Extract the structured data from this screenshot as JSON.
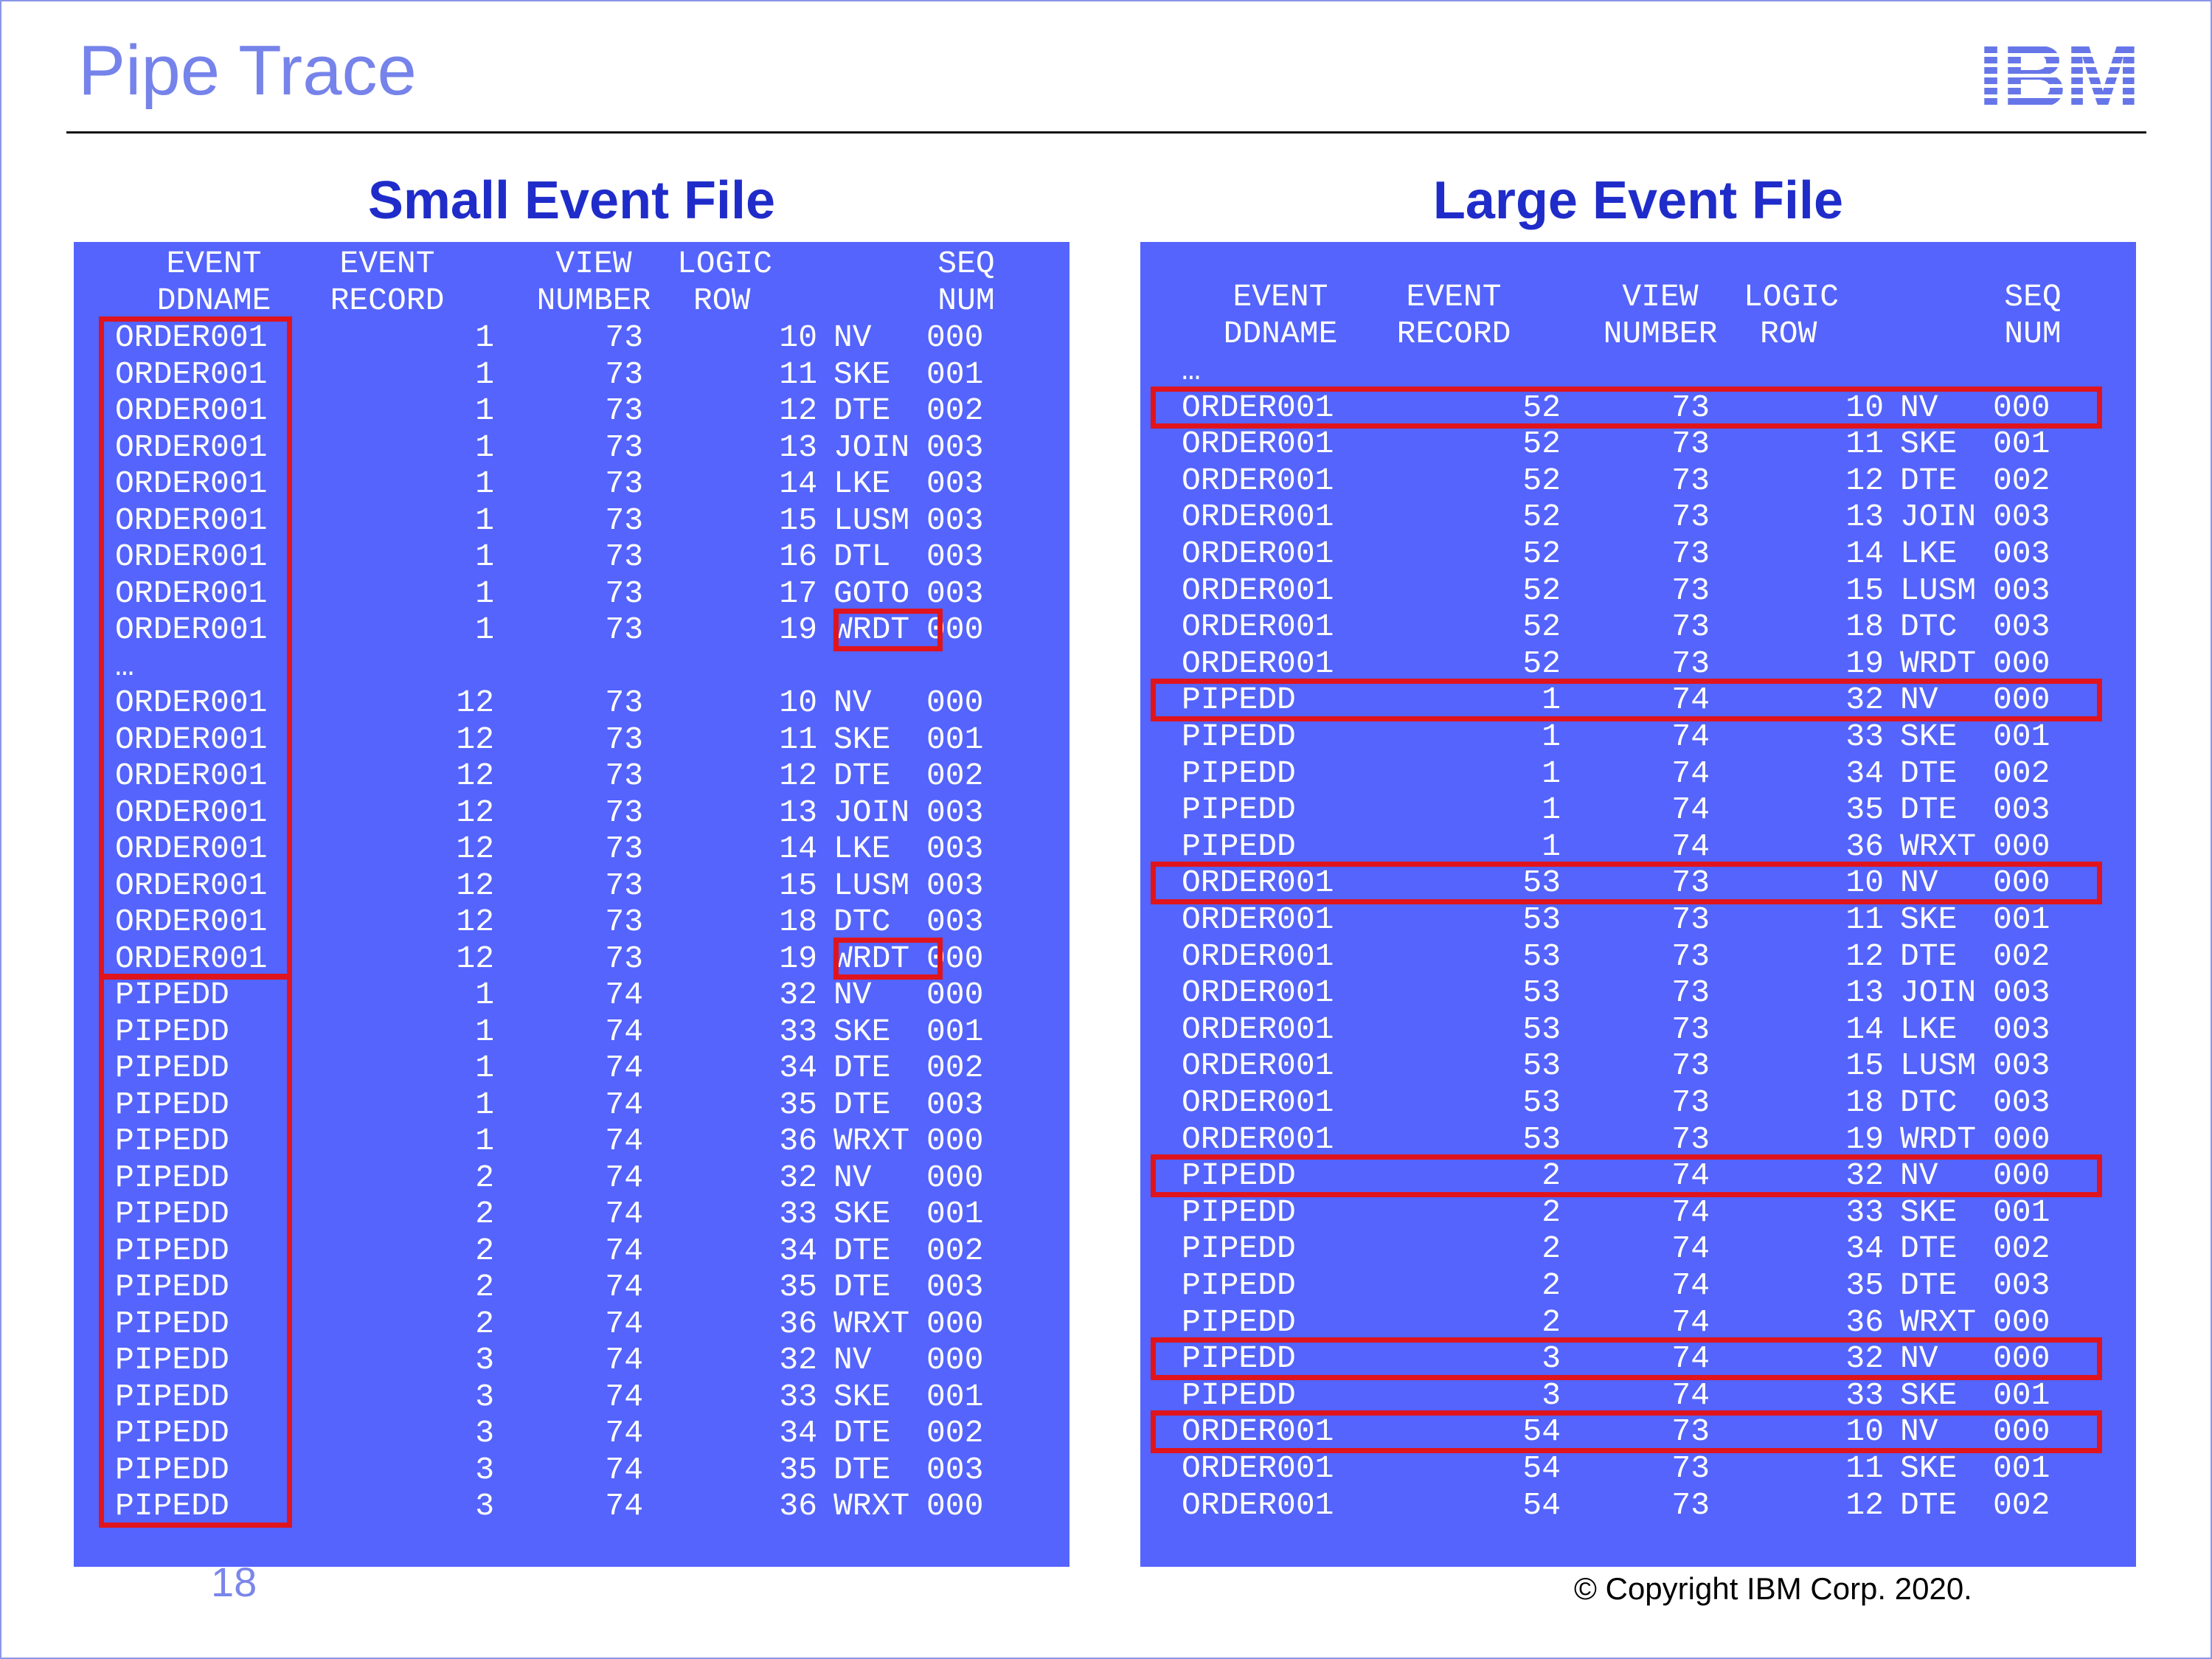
{
  "slide": {
    "title": "Pipe Trace",
    "logo": "IBM",
    "page_number": "18",
    "copyright": "© Copyright IBM Corp. 2020."
  },
  "colors": {
    "title": "#7683ea",
    "panel_background": "#5464fc",
    "panel_heading": "#1f2cc9",
    "highlight_box": "#e0141c"
  },
  "small_file": {
    "heading": "Small Event File",
    "header_row1": [
      "EVENT",
      "EVENT",
      "VIEW",
      "LOGIC",
      "SEQ"
    ],
    "header_row2": [
      "DDNAME",
      "RECORD",
      "NUMBER",
      "ROW",
      "NUM"
    ],
    "rows": [
      [
        "ORDER001",
        "1",
        "73",
        "10",
        "NV",
        "000"
      ],
      [
        "ORDER001",
        "1",
        "73",
        "11",
        "SKE",
        "001"
      ],
      [
        "ORDER001",
        "1",
        "73",
        "12",
        "DTE",
        "002"
      ],
      [
        "ORDER001",
        "1",
        "73",
        "13",
        "JOIN",
        "003"
      ],
      [
        "ORDER001",
        "1",
        "73",
        "14",
        "LKE",
        "003"
      ],
      [
        "ORDER001",
        "1",
        "73",
        "15",
        "LUSM",
        "003"
      ],
      [
        "ORDER001",
        "1",
        "73",
        "16",
        "DTL",
        "003"
      ],
      [
        "ORDER001",
        "1",
        "73",
        "17",
        "GOTO",
        "003"
      ],
      [
        "ORDER001",
        "1",
        "73",
        "19",
        "WRDT",
        "000"
      ],
      [
        "…"
      ],
      [
        "ORDER001",
        "12",
        "73",
        "10",
        "NV",
        "000"
      ],
      [
        "ORDER001",
        "12",
        "73",
        "11",
        "SKE",
        "001"
      ],
      [
        "ORDER001",
        "12",
        "73",
        "12",
        "DTE",
        "002"
      ],
      [
        "ORDER001",
        "12",
        "73",
        "13",
        "JOIN",
        "003"
      ],
      [
        "ORDER001",
        "12",
        "73",
        "14",
        "LKE",
        "003"
      ],
      [
        "ORDER001",
        "12",
        "73",
        "15",
        "LUSM",
        "003"
      ],
      [
        "ORDER001",
        "12",
        "73",
        "18",
        "DTC",
        "003"
      ],
      [
        "ORDER001",
        "12",
        "73",
        "19",
        "WRDT",
        "000"
      ],
      [
        "PIPEDD",
        "1",
        "74",
        "32",
        "NV",
        "000"
      ],
      [
        "PIPEDD",
        "1",
        "74",
        "33",
        "SKE",
        "001"
      ],
      [
        "PIPEDD",
        "1",
        "74",
        "34",
        "DTE",
        "002"
      ],
      [
        "PIPEDD",
        "1",
        "74",
        "35",
        "DTE",
        "003"
      ],
      [
        "PIPEDD",
        "1",
        "74",
        "36",
        "WRXT",
        "000"
      ],
      [
        "PIPEDD",
        "2",
        "74",
        "32",
        "NV",
        "000"
      ],
      [
        "PIPEDD",
        "2",
        "74",
        "33",
        "SKE",
        "001"
      ],
      [
        "PIPEDD",
        "2",
        "74",
        "34",
        "DTE",
        "002"
      ],
      [
        "PIPEDD",
        "2",
        "74",
        "35",
        "DTE",
        "003"
      ],
      [
        "PIPEDD",
        "2",
        "74",
        "36",
        "WRXT",
        "000"
      ],
      [
        "PIPEDD",
        "3",
        "74",
        "32",
        "NV",
        "000"
      ],
      [
        "PIPEDD",
        "3",
        "74",
        "33",
        "SKE",
        "001"
      ],
      [
        "PIPEDD",
        "3",
        "74",
        "34",
        "DTE",
        "002"
      ],
      [
        "PIPEDD",
        "3",
        "74",
        "35",
        "DTE",
        "003"
      ],
      [
        "PIPEDD",
        "3",
        "74",
        "36",
        "WRXT",
        "000"
      ]
    ]
  },
  "large_file": {
    "heading": "Large Event File",
    "header_row1": [
      "EVENT",
      "EVENT",
      "VIEW",
      "LOGIC",
      "SEQ"
    ],
    "header_row2": [
      "DDNAME",
      "RECORD",
      "NUMBER",
      "ROW",
      "NUM"
    ],
    "rows": [
      [
        "…"
      ],
      [
        "ORDER001",
        "52",
        "73",
        "10",
        "NV",
        "000"
      ],
      [
        "ORDER001",
        "52",
        "73",
        "11",
        "SKE",
        "001"
      ],
      [
        "ORDER001",
        "52",
        "73",
        "12",
        "DTE",
        "002"
      ],
      [
        "ORDER001",
        "52",
        "73",
        "13",
        "JOIN",
        "003"
      ],
      [
        "ORDER001",
        "52",
        "73",
        "14",
        "LKE",
        "003"
      ],
      [
        "ORDER001",
        "52",
        "73",
        "15",
        "LUSM",
        "003"
      ],
      [
        "ORDER001",
        "52",
        "73",
        "18",
        "DTC",
        "003"
      ],
      [
        "ORDER001",
        "52",
        "73",
        "19",
        "WRDT",
        "000"
      ],
      [
        "PIPEDD",
        "1",
        "74",
        "32",
        "NV",
        "000"
      ],
      [
        "PIPEDD",
        "1",
        "74",
        "33",
        "SKE",
        "001"
      ],
      [
        "PIPEDD",
        "1",
        "74",
        "34",
        "DTE",
        "002"
      ],
      [
        "PIPEDD",
        "1",
        "74",
        "35",
        "DTE",
        "003"
      ],
      [
        "PIPEDD",
        "1",
        "74",
        "36",
        "WRXT",
        "000"
      ],
      [
        "ORDER001",
        "53",
        "73",
        "10",
        "NV",
        "000"
      ],
      [
        "ORDER001",
        "53",
        "73",
        "11",
        "SKE",
        "001"
      ],
      [
        "ORDER001",
        "53",
        "73",
        "12",
        "DTE",
        "002"
      ],
      [
        "ORDER001",
        "53",
        "73",
        "13",
        "JOIN",
        "003"
      ],
      [
        "ORDER001",
        "53",
        "73",
        "14",
        "LKE",
        "003"
      ],
      [
        "ORDER001",
        "53",
        "73",
        "15",
        "LUSM",
        "003"
      ],
      [
        "ORDER001",
        "53",
        "73",
        "18",
        "DTC",
        "003"
      ],
      [
        "ORDER001",
        "53",
        "73",
        "19",
        "WRDT",
        "000"
      ],
      [
        "PIPEDD",
        "2",
        "74",
        "32",
        "NV",
        "000"
      ],
      [
        "PIPEDD",
        "2",
        "74",
        "33",
        "SKE",
        "001"
      ],
      [
        "PIPEDD",
        "2",
        "74",
        "34",
        "DTE",
        "002"
      ],
      [
        "PIPEDD",
        "2",
        "74",
        "35",
        "DTE",
        "003"
      ],
      [
        "PIPEDD",
        "2",
        "74",
        "36",
        "WRXT",
        "000"
      ],
      [
        "PIPEDD",
        "3",
        "74",
        "32",
        "NV",
        "000"
      ],
      [
        "PIPEDD",
        "3",
        "74",
        "33",
        "SKE",
        "001"
      ],
      [
        "ORDER001",
        "54",
        "73",
        "10",
        "NV",
        "000"
      ],
      [
        "ORDER001",
        "54",
        "73",
        "11",
        "SKE",
        "001"
      ],
      [
        "ORDER001",
        "54",
        "73",
        "12",
        "DTE",
        "002"
      ]
    ]
  }
}
